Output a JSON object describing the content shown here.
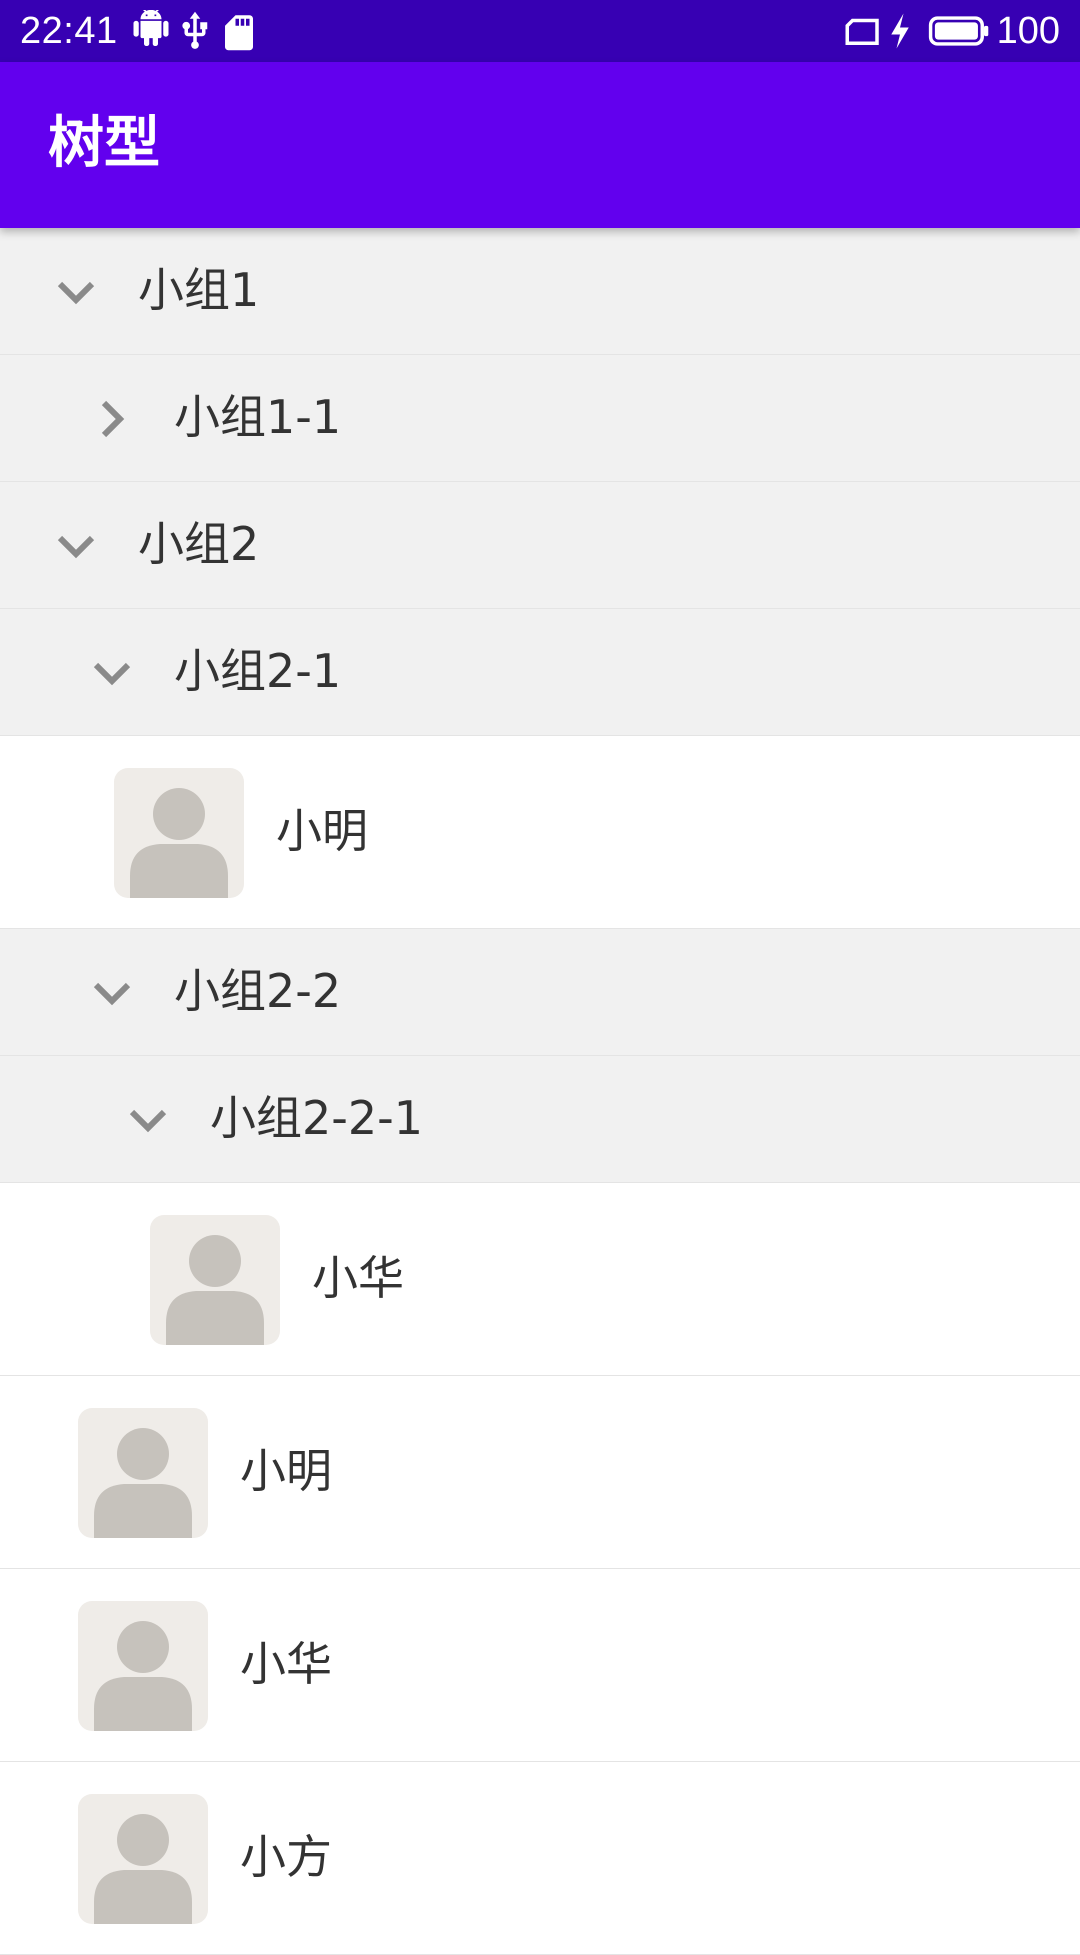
{
  "status_bar": {
    "time": "22:41",
    "left_icons": [
      "android-icon",
      "usb-icon",
      "sd-card-icon"
    ],
    "right_icons": [
      "screen-rotation-icon",
      "charging-bolt-icon",
      "battery-icon"
    ],
    "battery_level": "100"
  },
  "toolbar": {
    "title": "树型"
  },
  "colors": {
    "status_bar_bg": "#3700b3",
    "toolbar_bg": "#6200ee",
    "group_row_bg": "#f1f1f1",
    "member_row_bg": "#ffffff",
    "avatar_bg": "#efece8",
    "avatar_fg": "#c6c2bc",
    "arrow": "#8a8a8a"
  },
  "tree": {
    "rows": [
      {
        "type": "group",
        "label": "小组1",
        "expanded": true,
        "depth": 0
      },
      {
        "type": "group",
        "label": "小组1-1",
        "expanded": false,
        "depth": 1
      },
      {
        "type": "group",
        "label": "小组2",
        "expanded": true,
        "depth": 0
      },
      {
        "type": "group",
        "label": "小组2-1",
        "expanded": true,
        "depth": 1
      },
      {
        "type": "member",
        "label": "小明",
        "depth": 2
      },
      {
        "type": "group",
        "label": "小组2-2",
        "expanded": true,
        "depth": 1
      },
      {
        "type": "group",
        "label": "小组2-2-1",
        "expanded": true,
        "depth": 2
      },
      {
        "type": "member",
        "label": "小华",
        "depth": 3
      },
      {
        "type": "member",
        "label": "小明",
        "depth": 1
      },
      {
        "type": "member",
        "label": "小华",
        "depth": 1
      },
      {
        "type": "member",
        "label": "小方",
        "depth": 1
      }
    ]
  }
}
